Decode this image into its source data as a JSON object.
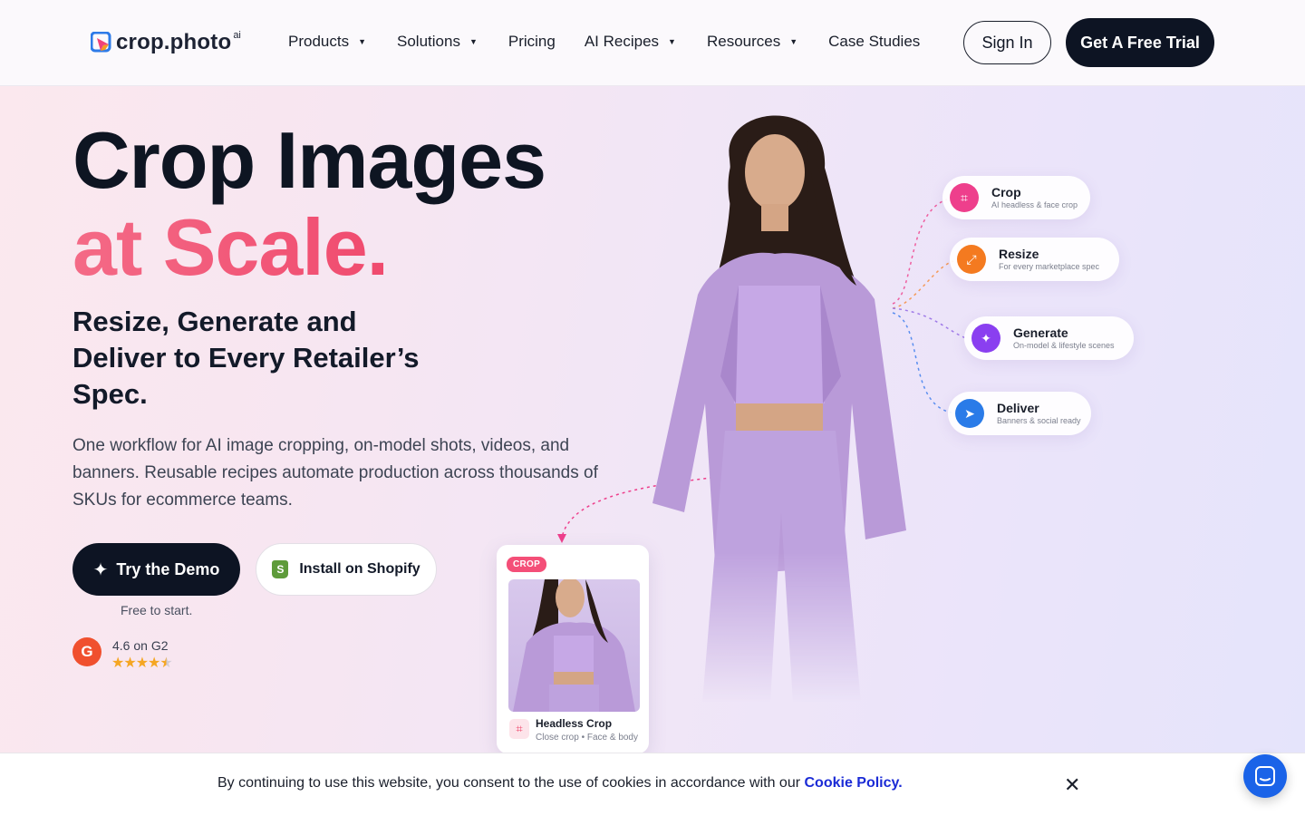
{
  "header": {
    "logo_text": "crop.photo",
    "logo_sup": "ai",
    "nav": [
      {
        "label": "Products",
        "dropdown": true
      },
      {
        "label": "Solutions",
        "dropdown": true
      },
      {
        "label": "Pricing",
        "dropdown": false
      },
      {
        "label": "AI Recipes",
        "dropdown": true
      },
      {
        "label": "Resources",
        "dropdown": true
      },
      {
        "label": "Case Studies",
        "dropdown": false
      }
    ],
    "signin_label": "Sign In",
    "trial_label": "Get A Free Trial"
  },
  "hero": {
    "title_line1": "Crop Images",
    "title_line2": "at Scale.",
    "subtitle": "Resize, Generate and Deliver to Every Retailer’s Spec.",
    "description": "One workflow for AI image cropping, on-model shots, videos, and banners. Reusable recipes automate production across thousands of SKUs for ecommerce teams.",
    "demo_label": "Try the Demo",
    "shopify_label": "Install on Shopify",
    "free_note": "Free to start.",
    "rating_text": "4.6 on G2",
    "rating_value": 4.6,
    "g2_letter": "G"
  },
  "features": [
    {
      "title": "Crop",
      "caption": "AI headless & face crop",
      "color": "#ee3f8c",
      "icon": "crop-icon"
    },
    {
      "title": "Resize",
      "caption": "For every marketplace spec",
      "color": "#f47a20",
      "icon": "resize-icon"
    },
    {
      "title": "Generate",
      "caption": "On-model & lifestyle scenes",
      "color": "#8a3ff0",
      "icon": "sparkle-icon"
    },
    {
      "title": "Deliver",
      "caption": "Banners & social ready",
      "color": "#2a7be8",
      "icon": "send-icon"
    }
  ],
  "crop_card": {
    "tag": "CROP",
    "title": "Headless Crop",
    "caption": "Close crop • Face & body"
  },
  "cookie": {
    "text": "By continuing to use this website, you consent to the use of cookies in accordance with our",
    "link": "Cookie Policy.",
    "close": "✕"
  }
}
